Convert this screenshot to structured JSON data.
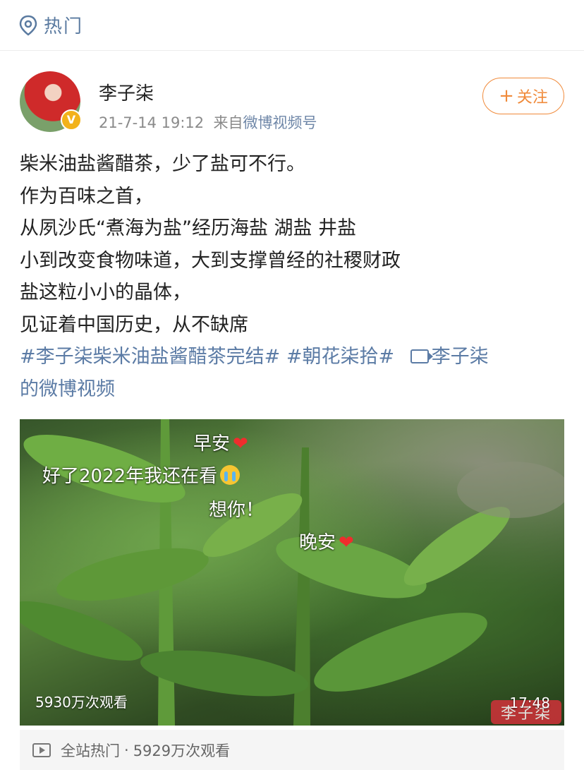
{
  "topbar": {
    "icon": "location-pin-icon",
    "title": "热门"
  },
  "post": {
    "author": "李子柒",
    "verified_badge": "V",
    "time": "21-7-14 19:12",
    "source_prefix": "来自",
    "source": "微博视频号",
    "follow_label": "关注",
    "follow_plus": "+",
    "lines": [
      "柴米油盐酱醋茶，少了盐可不行。",
      "作为百味之首，",
      "从夙沙氏“煮海为盐”经历海盐 湖盐 井盐",
      "小到改变食物味道，大到支撑曾经的社稷财政",
      "盐这粒小小的晶体，",
      "见证着中国历史，从不缺席"
    ],
    "tag1": "#李子柒柴米油盐酱醋茶完结#",
    "tag2": "#朝花柒拾#",
    "video_link_part1": "李子柒",
    "video_link_part2": "的微博视频"
  },
  "video": {
    "danmaku": [
      {
        "text": "早安",
        "emoji": "❤"
      },
      {
        "text": "好了2022年我还在看",
        "emoji": "crying-face"
      },
      {
        "text": "想你！",
        "emoji": ""
      },
      {
        "text": "晚安",
        "emoji": "❤"
      }
    ],
    "views": "5930万次观看",
    "duration": "17:48",
    "watermark": "李子柒"
  },
  "stats": {
    "icon": "video-play-icon",
    "label": "全站热门",
    "separator": "·",
    "views": "5929万次观看"
  },
  "colors": {
    "link": "#5b7ba5",
    "follow": "#f08a3a",
    "verified": "#f2b21a",
    "heart": "#ef2d2d"
  }
}
